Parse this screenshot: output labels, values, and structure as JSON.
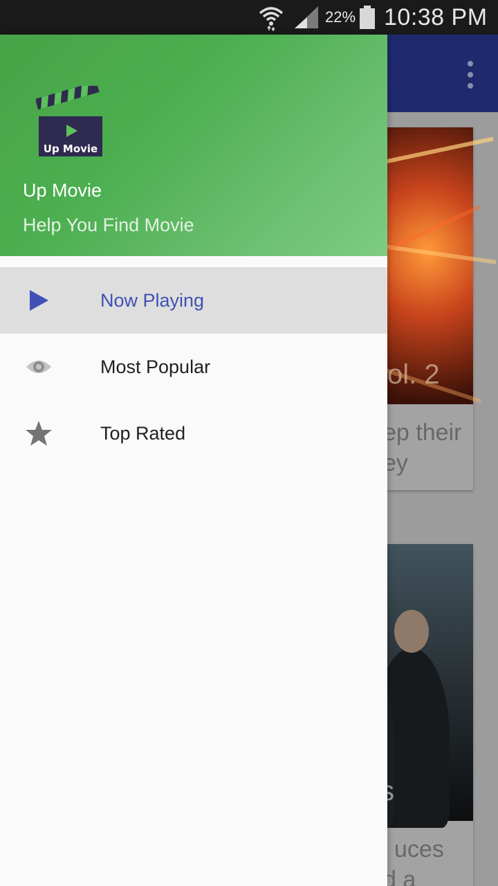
{
  "status_bar": {
    "battery_percent": "22%",
    "time": "10:38 PM",
    "icons": [
      "wifi-icon",
      "signal-icon",
      "battery-icon"
    ]
  },
  "drawer": {
    "header": {
      "logo_text": "Up Movie",
      "title": "Up Movie",
      "subtitle": "Help You Find Movie",
      "gradient_start": "#47a447",
      "gradient_end": "#7fcb83"
    },
    "items": [
      {
        "label": "Now Playing",
        "icon": "play-icon",
        "selected": true
      },
      {
        "label": "Most Popular",
        "icon": "eye-icon",
        "selected": false
      },
      {
        "label": "Top Rated",
        "icon": "star-icon",
        "selected": false
      }
    ],
    "accent_color": "#3f51b5"
  },
  "background": {
    "toolbar_color": "#1f2a6e",
    "card1": {
      "poster_text": "ol. 2",
      "desc_line1": "ep their",
      "desc_line2": "ey"
    },
    "card2": {
      "poster_text": "s",
      "desc_line1": "uces",
      "desc_line2": "d a"
    }
  }
}
